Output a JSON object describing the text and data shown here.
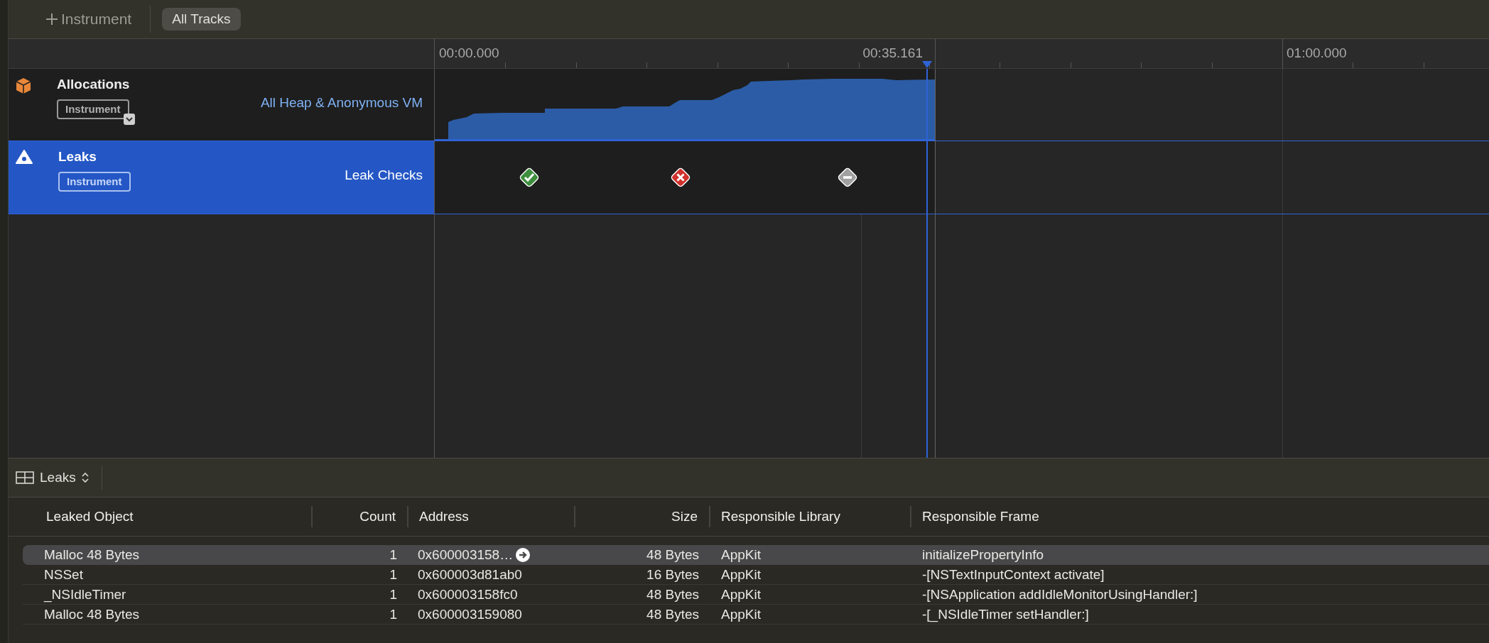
{
  "toolbar": {
    "add_button": "Instrument",
    "filter": "All Tracks"
  },
  "ruler": {
    "labels": [
      {
        "text": "00:00.000",
        "kind": "start"
      },
      {
        "text": "00:35.161",
        "kind": "playhead"
      },
      {
        "text": "01:00.000",
        "kind": "minute"
      }
    ]
  },
  "tracks": [
    {
      "kind": "allocations",
      "name": "Allocations",
      "badge": "Instrument",
      "detail": "All Heap & Anonymous VM",
      "selected": false
    },
    {
      "kind": "leaks",
      "name": "Leaks",
      "badge": "Instrument",
      "detail": "Leak Checks",
      "selected": true,
      "checks": [
        {
          "kind": "pass"
        },
        {
          "kind": "leak"
        },
        {
          "kind": "none"
        }
      ]
    }
  ],
  "detail": {
    "view": "Leaks",
    "columns": [
      {
        "label": "Leaked Object"
      },
      {
        "label": "Count"
      },
      {
        "label": "Address"
      },
      {
        "label": "Size"
      },
      {
        "label": "Responsible Library"
      },
      {
        "label": "Responsible Frame"
      }
    ],
    "rows": [
      {
        "selected": true,
        "cells": [
          "Malloc 48 Bytes",
          "1",
          "0x600003158…",
          "48 Bytes",
          "AppKit",
          "initializePropertyInfo"
        ]
      },
      {
        "selected": false,
        "cells": [
          "NSSet",
          "1",
          "0x600003d81ab0",
          "16 Bytes",
          "AppKit",
          "-[NSTextInputContext activate]"
        ]
      },
      {
        "selected": false,
        "cells": [
          "_NSIdleTimer",
          "1",
          "0x600003158fc0",
          "48 Bytes",
          "AppKit",
          "-[NSApplication addIdleMonitorUsingHandler:]"
        ]
      },
      {
        "selected": false,
        "cells": [
          "Malloc 48 Bytes",
          "1",
          "0x600003159080",
          "48 Bytes",
          "AppKit",
          "-[_NSIdleTimer setHandler:]"
        ]
      }
    ]
  }
}
